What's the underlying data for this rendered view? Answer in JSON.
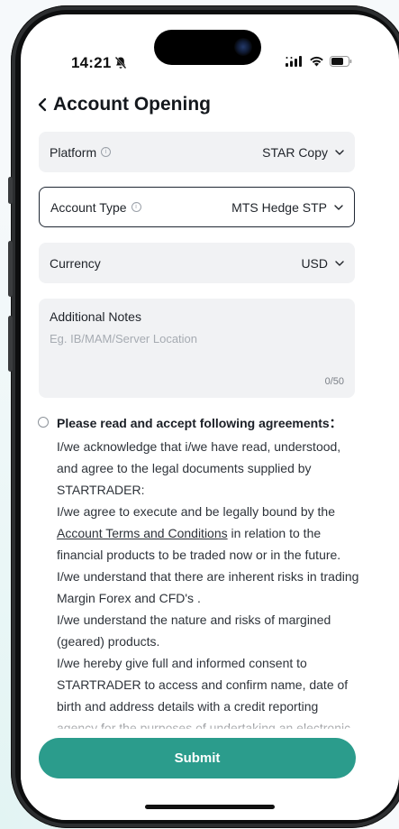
{
  "status_bar": {
    "time": "14:21"
  },
  "header": {
    "title": "Account Opening"
  },
  "form": {
    "platform": {
      "label": "Platform",
      "value": "STAR Copy"
    },
    "account_type": {
      "label": "Account Type",
      "value": "MTS Hedge STP"
    },
    "currency": {
      "label": "Currency",
      "value": "USD"
    },
    "notes": {
      "label": "Additional Notes",
      "placeholder": "Eg. IB/MAM/Server Location",
      "counter": "0/50"
    }
  },
  "agreements": {
    "heading": "Please read and accept following agreements：",
    "p1": "I/we acknowledge that i/we have read, understood, and agree to the legal documents supplied by STARTRADER:",
    "p2_before": "I/we agree to execute and be legally bound by the ",
    "p2_link": "Account Terms and Conditions",
    "p2_after": " in relation to the financial products to be traded now or in the future.",
    "p3": "I/we understand that there are inherent risks in trading Margin Forex and CFD's .",
    "p4": "I/we understand the nature and risks of margined (geared) products.",
    "p5": "I/we hereby give full and informed consent to STARTRADER to access and confirm name, date of birth and address details with a credit reporting agency for the purposes of undertaking an electronic"
  },
  "actions": {
    "submit": "Submit"
  },
  "colors": {
    "accent": "#2b9c8c",
    "field_bg": "#f1f2f4",
    "selected_border": "#1f2733"
  }
}
